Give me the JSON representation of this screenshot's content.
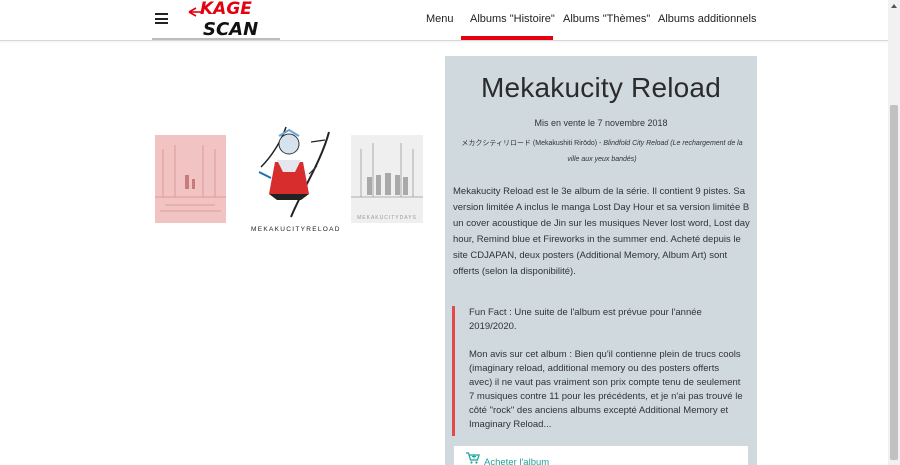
{
  "header": {
    "logo_text": "KAGE SCAN",
    "nav": [
      {
        "label": "Menu"
      },
      {
        "label": "Albums \"Histoire\""
      },
      {
        "label": "Albums \"Thèmes\""
      },
      {
        "label": "Albums additionnels"
      }
    ]
  },
  "covers": {
    "left_caption": "MEKAKUCITYDAYS",
    "center_caption": "MEKAKUCITYRELOAD",
    "right_caption": "MEKAKUCITYDAYS"
  },
  "album": {
    "title": "Mekakucity Reload",
    "release": "Mis en vente le 7 novembre 2018",
    "jp_title": "メカクシティリロード",
    "jp_romaji": "(Mekakushiti Rirōdo) - ",
    "jp_translation": "Blindfold City Reload (Le rechargement de la ville aux yeux bandés)",
    "description": "Mekakucity Reload est le 3e album de la série. Il contient 9 pistes. Sa version limitée A inclus le manga Lost Day Hour et sa version limitée B un cover acoustique de Jin sur les musiques Never lost word, Lost day hour, Remind blue et Fireworks in the summer end. Acheté depuis le site CDJAPAN, deux posters (Additional Memory, Album Art) sont offerts (selon la disponibilité).",
    "fun_fact": "Fun Fact : Une suite de l'album est prévue pour l'année 2019/2020.",
    "opinion": "Mon avis sur cet album : Bien qu'il contienne plein de trucs cools (imaginary reload, additional memory ou des posters offerts avec) il ne vaut pas vraiment son prix compte tenu de seulement 7 musiques contre 11 pour les précédents, et je n'ai pas trouvé le côté \"rock\" des anciens albums excepté Additional Memory et Imaginary Reload...",
    "buy_label": "Acheter l'album"
  },
  "colors": {
    "accent": "#e3000f",
    "card_bg": "#cfd9de",
    "quote_border": "#e24a4a",
    "link": "#1fa39a"
  }
}
